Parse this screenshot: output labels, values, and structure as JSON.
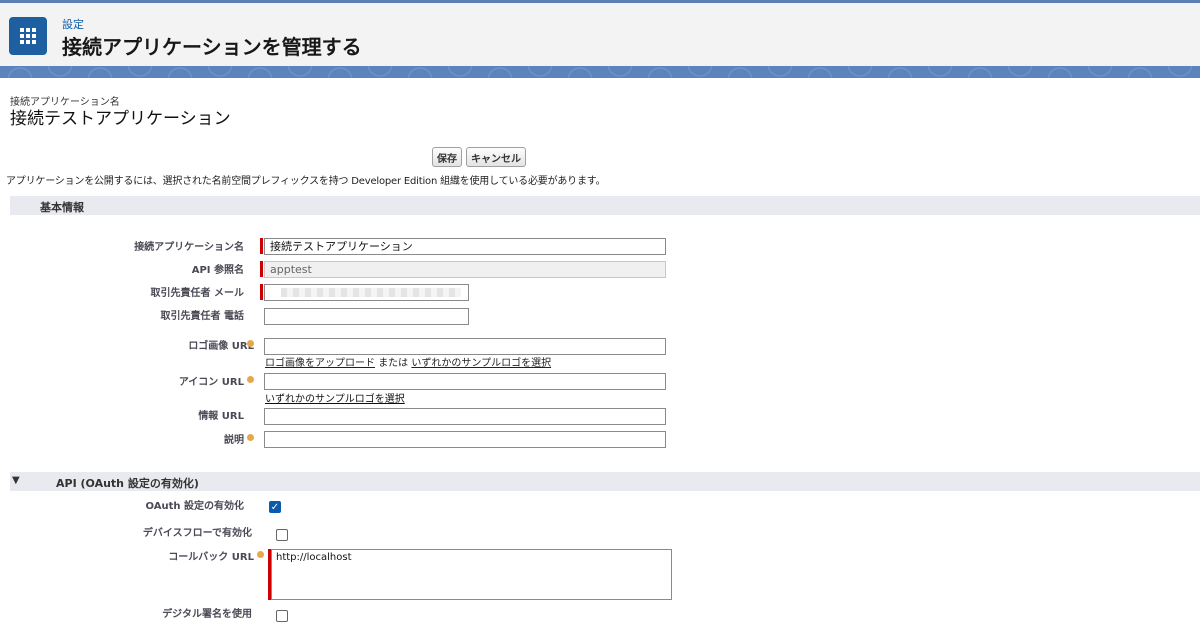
{
  "header": {
    "breadcrumb": "設定",
    "title": "接続アプリケーションを管理する"
  },
  "app": {
    "section_label": "接続アプリケーション名",
    "name": "接続テストアプリケーション"
  },
  "buttons": {
    "save": "保存",
    "cancel": "キャンセル"
  },
  "notice": "アプリケーションを公開するには、選択された名前空間プレフィックスを持つ Developer Edition 組織を使用している必要があります。",
  "basic": {
    "header": "基本情報",
    "fields": {
      "app_name_label": "接続アプリケーション名",
      "app_name_value": "接続テストアプリケーション",
      "api_name_label": "API 参照名",
      "api_name_value": "apptest",
      "contact_email_label": "取引先責任者 メール",
      "contact_phone_label": "取引先責任者 電話",
      "logo_url_label": "ロゴ画像 URL",
      "logo_upload_link": "ロゴ画像をアップロード",
      "or_text": "または",
      "logo_sample_link": "いずれかのサンプルロゴを選択",
      "icon_url_label": "アイコン URL",
      "icon_sample_link": "いずれかのサンプルロゴを選択",
      "info_url_label": "情報 URL",
      "description_label": "説明"
    }
  },
  "api": {
    "header": "API (OAuth 設定の有効化)",
    "oauth_enable_label": "OAuth 設定の有効化",
    "oauth_enabled": true,
    "device_flow_label": "デバイスフローで有効化",
    "device_flow_enabled": false,
    "callback_url_label": "コールバック URL",
    "callback_url_value": "http://localhost",
    "digital_signature_label": "デジタル署名を使用",
    "digital_signature_enabled": false
  },
  "colors": {
    "brand": "#1d5fa0",
    "band": "#5b84bd",
    "required": "#cc0000",
    "checkbox_checked": "#0b5cab"
  }
}
